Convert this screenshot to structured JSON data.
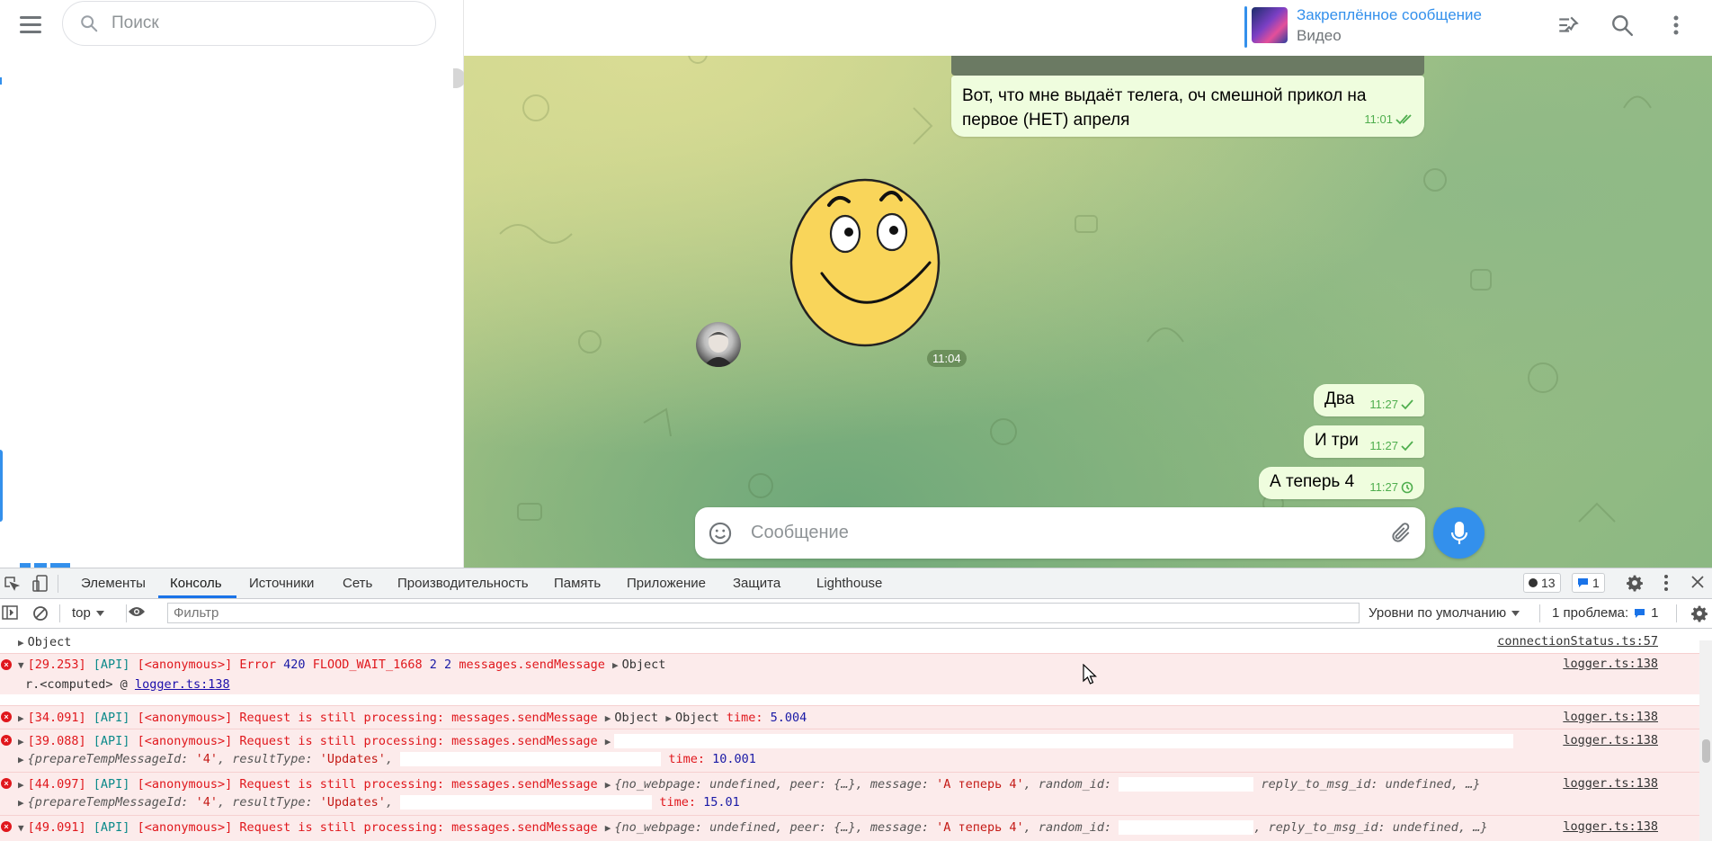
{
  "sidebar": {
    "search_placeholder": "Поиск"
  },
  "chat": {
    "pinned": {
      "title": "Закреплённое сообщение",
      "subtitle": "Видео"
    },
    "messages": [
      {
        "text": "Вот, что мне выдаёт телега, оч смешной прикол на первое (НЕТ) апреля",
        "time": "11:01",
        "status": "read"
      },
      {
        "text": "Два",
        "time": "11:27",
        "status": "sent"
      },
      {
        "text": "И три",
        "time": "11:27",
        "status": "sent"
      },
      {
        "text": "А теперь 4",
        "time": "11:27",
        "status": "pending"
      }
    ],
    "sticker_time": "11:04",
    "composer_placeholder": "Сообщение",
    "colors": {
      "accent": "#3390ec",
      "bubble": "#effdde",
      "check": "#4fae4e"
    }
  },
  "devtools": {
    "tabs": [
      "Элементы",
      "Консоль",
      "Источники",
      "Сеть",
      "Производительность",
      "Память",
      "Приложение",
      "Защита",
      "Lighthouse"
    ],
    "active_tab": "Консоль",
    "error_count": "13",
    "message_count": "1",
    "context": "top",
    "filter_placeholder": "Фильтр",
    "levels": "Уровни по умолчанию",
    "problems_label": "1 проблема:",
    "problems_count": "1",
    "logs": {
      "l0": {
        "text": "Object",
        "src": "connectionStatus.ts:57"
      },
      "l1": {
        "time": "[29.253]",
        "tag": "[API]",
        "anon": "[<anonymous>]",
        "msg": "Error",
        "code": "420",
        "flood": "FLOOD_WAIT_1668",
        "n1": "2",
        "n2": "2",
        "method": "messages.sendMessage",
        "obj": "Object",
        "src": "logger.ts:138",
        "stack_prefix": "r.<computed> @",
        "stack_link": "logger.ts:138"
      },
      "l2": {
        "time": "[34.091]",
        "tag": "[API]",
        "anon": "[<anonymous>]",
        "msg": "Request is still processing: messages.sendMessage",
        "obj1": "Object",
        "obj2": "Object",
        "time_label": "time:",
        "time_val": "5.004",
        "src": "logger.ts:138"
      },
      "l3": {
        "time": "[39.088]",
        "tag": "[API]",
        "anon": "[<anonymous>]",
        "msg": "Request is still processing: messages.sendMessage",
        "sub_prefix": "{prepareTempMessageId:",
        "sub_id": "'4'",
        "sub_rt": ", resultType:",
        "sub_upd": "'Updates'",
        "sub_comma": ",",
        "time_label": "time:",
        "time_val": "10.001",
        "src": "logger.ts:138"
      },
      "l4": {
        "time": "[44.097]",
        "tag": "[API]",
        "anon": "[<anonymous>]",
        "msg": "Request is still processing: messages.sendMessage",
        "obj_a": "{no_webpage:",
        "obj_b": "undefined",
        "obj_c": ", peer: {…}, message:",
        "obj_d": "'А теперь 4'",
        "obj_e": ", random_id:",
        "obj_f": "reply_to_msg_id:",
        "obj_g": "undefined",
        "obj_h": ", …}",
        "sub_prefix": "{prepareTempMessageId:",
        "sub_id": "'4'",
        "sub_rt": ", resultType:",
        "sub_upd": "'Updates'",
        "sub_comma": ",",
        "time_label": "time:",
        "time_val": "15.01",
        "src": "logger.ts:138"
      },
      "l5": {
        "time": "[49.091]",
        "tag": "[API]",
        "anon": "[<anonymous>]",
        "msg": "Request is still processing: messages.sendMessage",
        "obj_a": "{no_webpage:",
        "obj_b": "undefined",
        "obj_c": ", peer: {…}, message:",
        "obj_d": "'А теперь 4'",
        "obj_e": ", random_id:",
        "obj_f": ", reply_to_msg_id:",
        "obj_g": "undefined",
        "obj_h": ", …}",
        "src": "logger.ts:138"
      }
    }
  }
}
